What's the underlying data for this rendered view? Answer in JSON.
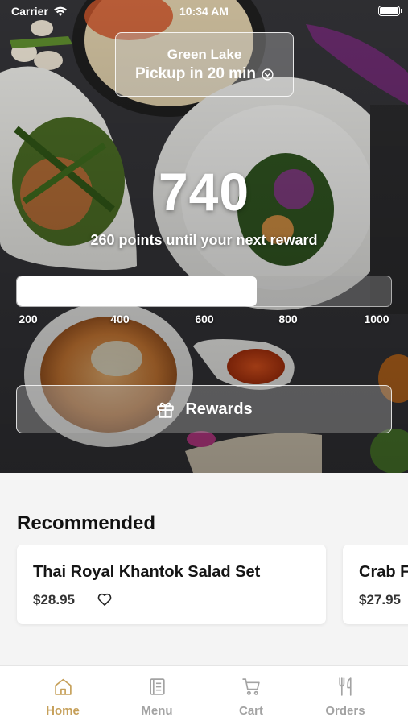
{
  "status_bar": {
    "carrier": "Carrier",
    "time": "10:34 AM"
  },
  "location": {
    "name": "Green Lake",
    "pickup": "Pickup in 20 min"
  },
  "rewards": {
    "points": "740",
    "caption": "260 points until your next reward",
    "progress_fraction": 0.64,
    "ticks": [
      "200",
      "400",
      "600",
      "800",
      "1000"
    ],
    "button_label": "Rewards"
  },
  "recommended": {
    "title": "Recommended",
    "items": [
      {
        "name": "Thai Royal Khantok Salad Set",
        "price": "$28.95"
      },
      {
        "name": "Crab Fried Rice",
        "price": "$27.95"
      }
    ]
  },
  "tabs": [
    {
      "label": "Home",
      "icon": "home-icon",
      "active": true
    },
    {
      "label": "Menu",
      "icon": "menu-icon",
      "active": false
    },
    {
      "label": "Cart",
      "icon": "cart-icon",
      "active": false
    },
    {
      "label": "Orders",
      "icon": "orders-icon",
      "active": false
    }
  ],
  "colors": {
    "accent": "#c6a05a",
    "inactive_tab": "#a3a3a3",
    "background": "#f4f4f4"
  }
}
